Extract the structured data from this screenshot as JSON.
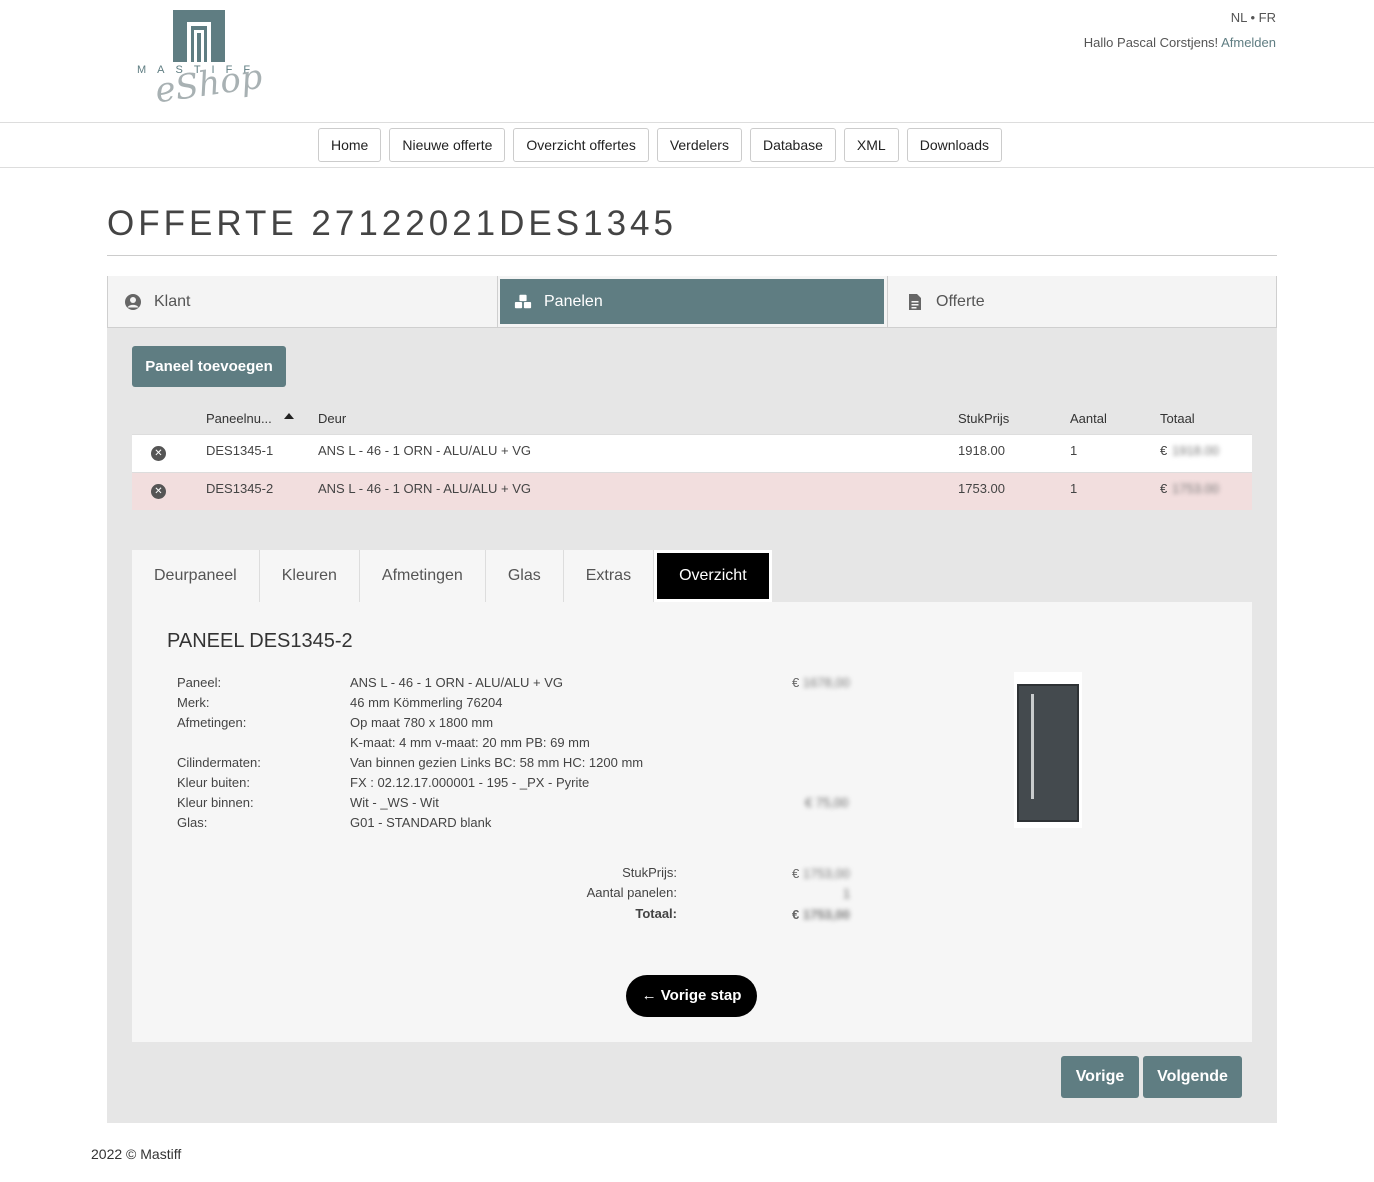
{
  "header": {
    "logo_word": "MASTIFF",
    "logo_script": "eShop",
    "lang_nl": "NL",
    "lang_sep": "•",
    "lang_fr": "FR",
    "greeting": "Hallo Pascal Corstjens!",
    "logout": "Afmelden"
  },
  "nav": [
    "Home",
    "Nieuwe offerte",
    "Overzicht offertes",
    "Verdelers",
    "Database",
    "XML",
    "Downloads"
  ],
  "page_title": "OFFERTE 27122021DES1345",
  "steps": {
    "klant": "Klant",
    "panelen": "Panelen",
    "offerte": "Offerte"
  },
  "add_panel": "Paneel toevoegen",
  "grid": {
    "columns": [
      "Paneelnu...",
      "Deur",
      "StukPrijs",
      "Aantal",
      "Totaal"
    ],
    "rows": [
      {
        "id": "DES1345-1",
        "door": "ANS L - 46 - 1 ORN - ALU/ALU + VG",
        "price": "1918.00",
        "qty": "1",
        "currency": "€",
        "total": "1918.00"
      },
      {
        "id": "DES1345-2",
        "door": "ANS L - 46 - 1 ORN - ALU/ALU + VG",
        "price": "1753.00",
        "qty": "1",
        "currency": "€",
        "total": "1753.00"
      }
    ]
  },
  "tabs": [
    "Deurpaneel",
    "Kleuren",
    "Afmetingen",
    "Glas",
    "Extras",
    "Overzicht"
  ],
  "overview": {
    "title": "PANEEL DES1345-2",
    "labels": [
      "Paneel:",
      "Merk:",
      "Afmetingen:",
      "Cilindermaten:",
      "Kleur buiten:",
      "Kleur binnen:",
      "Glas:"
    ],
    "values": [
      "ANS L - 46 - 1 ORN - ALU/ALU + VG",
      "46 mm Kömmerling 76204",
      "Op maat 780 x 1800 mm",
      "K-maat: 4 mm v-maat: 20 mm PB: 69 mm",
      "Van binnen gezien Links BC: 58 mm HC: 1200 mm",
      "FX : 02.12.17.000001 - 195 - _PX - Pyrite",
      "Wit - _WS - Wit",
      "G01 - STANDARD blank"
    ],
    "price_panel_cur": "€",
    "price_panel": "1678,00",
    "price_color": "€ 75,00",
    "sum_labels": [
      "StukPrijs:",
      "Aantal panelen:",
      "Totaal:"
    ],
    "sum_cur": "€",
    "sum_stuk": "1753,00",
    "sum_qty": "1",
    "sum_total": "1753,00",
    "back": "← Vorige stap"
  },
  "buttons": {
    "prev": "Vorige",
    "next": "Volgende"
  },
  "footer": "2022 © Mastiff"
}
